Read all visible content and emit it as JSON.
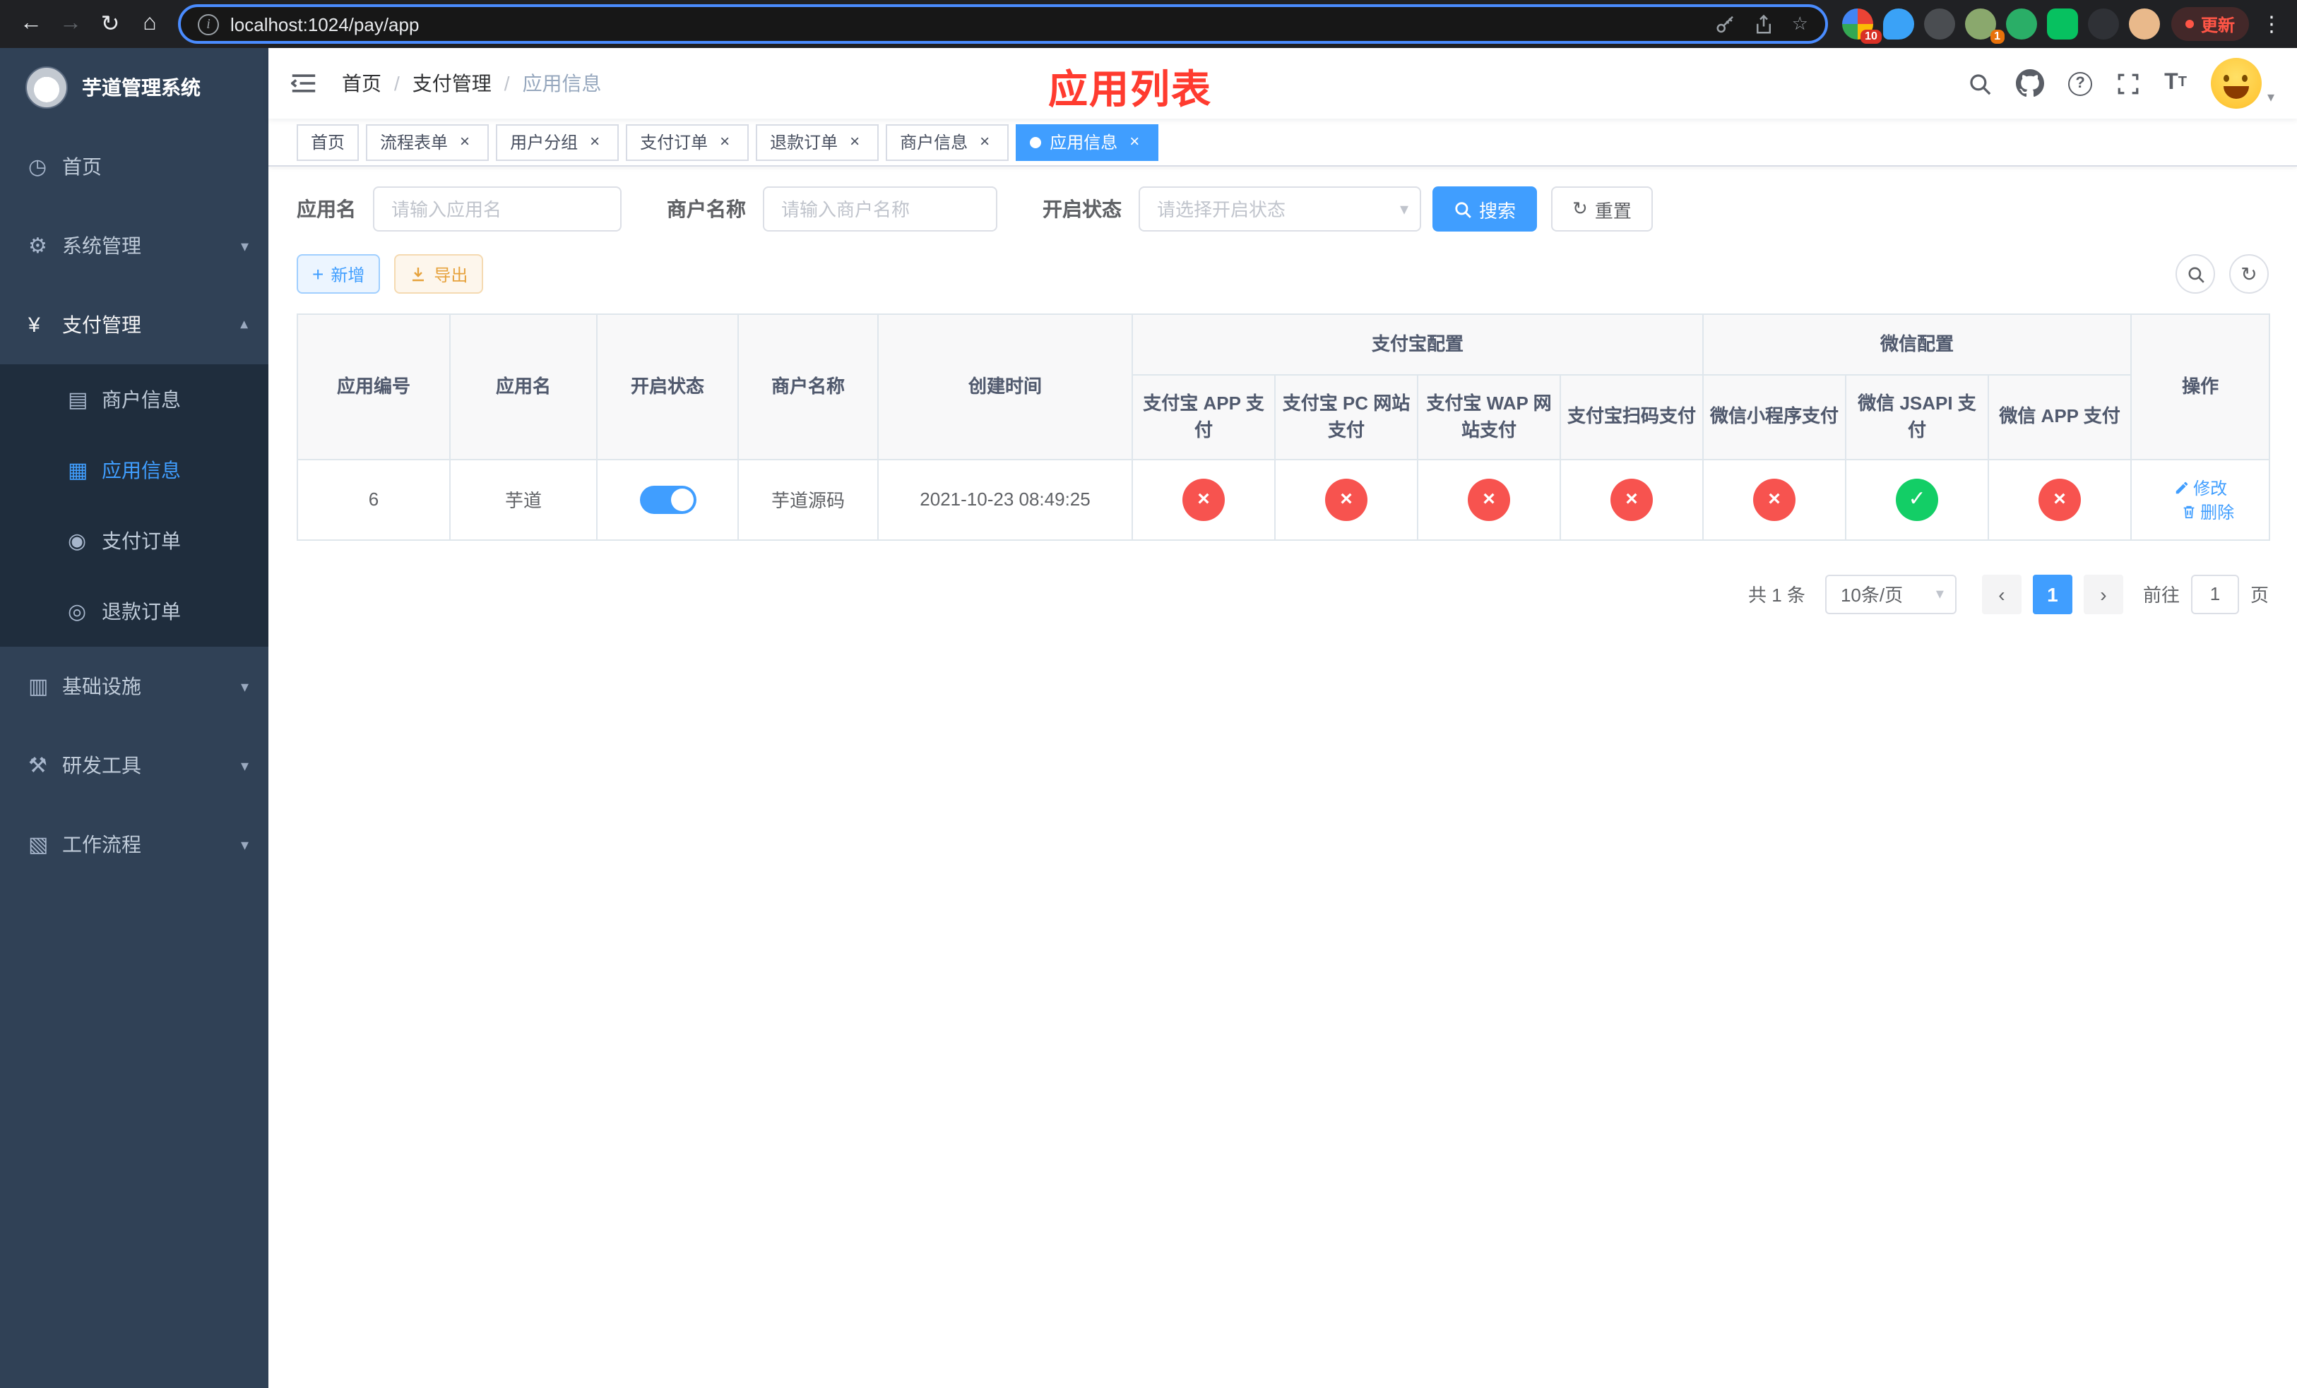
{
  "browser": {
    "url": "localhost:1024/pay/app",
    "update_label": "更新",
    "extension_badges": {
      "first": "10",
      "profile": "1"
    }
  },
  "sidebar": {
    "title": "芋道管理系统",
    "items": [
      {
        "label": "首页"
      },
      {
        "label": "系统管理"
      },
      {
        "label": "支付管理"
      },
      {
        "label": "商户信息"
      },
      {
        "label": "应用信息"
      },
      {
        "label": "支付订单"
      },
      {
        "label": "退款订单"
      },
      {
        "label": "基础设施"
      },
      {
        "label": "研发工具"
      },
      {
        "label": "工作流程"
      }
    ]
  },
  "navbar": {
    "breadcrumb": [
      "首页",
      "支付管理",
      "应用信息"
    ],
    "annotation": "应用列表"
  },
  "tabs": [
    {
      "label": "首页",
      "closable": false,
      "active": false
    },
    {
      "label": "流程表单",
      "closable": true,
      "active": false
    },
    {
      "label": "用户分组",
      "closable": true,
      "active": false
    },
    {
      "label": "支付订单",
      "closable": true,
      "active": false
    },
    {
      "label": "退款订单",
      "closable": true,
      "active": false
    },
    {
      "label": "商户信息",
      "closable": true,
      "active": false
    },
    {
      "label": "应用信息",
      "closable": true,
      "active": true
    }
  ],
  "filters": {
    "app_name_label": "应用名",
    "app_name_placeholder": "请输入应用名",
    "merchant_label": "商户名称",
    "merchant_placeholder": "请输入商户名称",
    "status_label": "开启状态",
    "status_placeholder": "请选择开启状态",
    "search_label": "搜索",
    "reset_label": "重置"
  },
  "toolbar": {
    "add_label": "新增",
    "export_label": "导出"
  },
  "table": {
    "base_columns": [
      "应用编号",
      "应用名",
      "开启状态",
      "商户名称",
      "创建时间"
    ],
    "alipay_group": "支付宝配置",
    "wechat_group": "微信配置",
    "alipay_columns": [
      "支付宝 APP 支付",
      "支付宝 PC 网站支付",
      "支付宝 WAP 网站支付",
      "支付宝扫码支付"
    ],
    "wechat_columns": [
      "微信小程序支付",
      "微信 JSAPI 支付",
      "微信 APP 支付"
    ],
    "ops_column": "操作",
    "rows": [
      {
        "id": "6",
        "name": "芋道",
        "enabled": true,
        "merchant": "芋道源码",
        "created_at": "2021-10-23 08:49:25",
        "configs": [
          "no",
          "no",
          "no",
          "no",
          "no",
          "yes",
          "no"
        ],
        "edit_label": "修改",
        "delete_label": "删除"
      }
    ]
  },
  "pagination": {
    "total": "共 1 条",
    "page_size": "10条/页",
    "page": "1",
    "goto_label": "前往",
    "goto_value": "1",
    "unit_label": "页"
  },
  "colors": {
    "primary": "#409eff",
    "danger": "#f7534f",
    "success": "#13ce66",
    "warning": "#e6a23c",
    "annotation": "#ff3b2f",
    "sidebar_bg": "#304156",
    "submenu_bg": "#1f2d3d"
  }
}
